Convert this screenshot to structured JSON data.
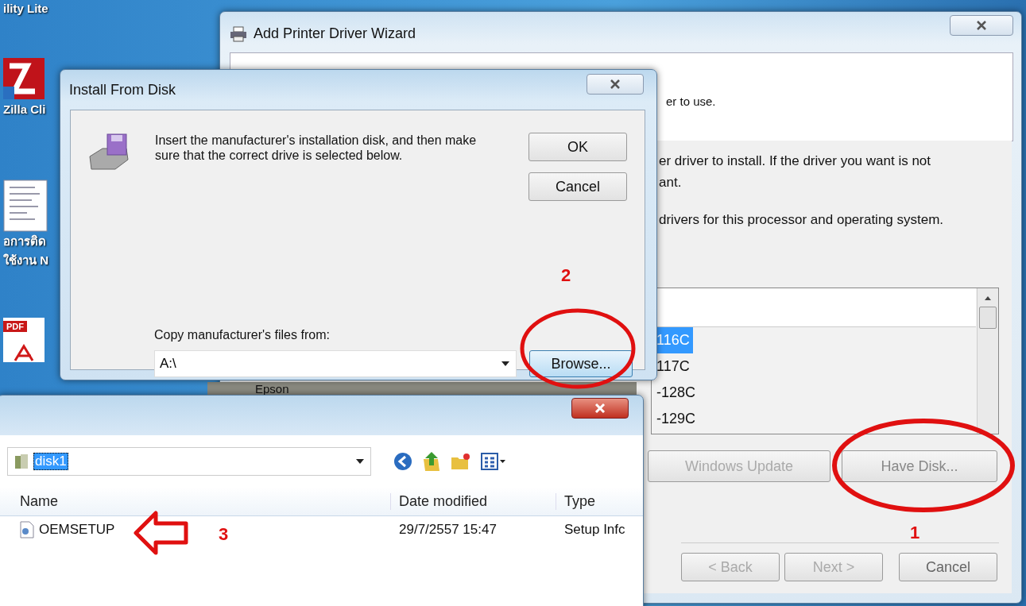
{
  "desktop": {
    "icons": [
      {
        "kind": "none",
        "lines": [
          "ility Lite"
        ]
      },
      {
        "kind": "filezilla",
        "lines": [
          "Zilla Cli"
        ]
      },
      {
        "kind": "document",
        "lines": [
          "อการติด",
          "ใช้งาน N"
        ]
      },
      {
        "kind": "pdf",
        "badge": "PDF"
      }
    ]
  },
  "wizard": {
    "title": "Add Printer Driver Wizard",
    "header_text": "er to use.",
    "body_lines": [
      "er driver to install. If the driver you want is not",
      "ant."
    ],
    "filter_text": "drivers for this processor and operating system.",
    "manufacturer_item": "Epson",
    "printer_items": [
      {
        "label": "116C",
        "selected": true
      },
      {
        "label": "117C",
        "selected": false
      },
      {
        "label": "-128C",
        "selected": false
      },
      {
        "label": "-129C",
        "selected": false
      }
    ],
    "buttons": [
      {
        "label": "Windows Update",
        "disabled": true
      },
      {
        "label": "Have Disk...",
        "disabled": false
      }
    ],
    "nav_buttons": [
      {
        "label": "< Back",
        "disabled": true
      },
      {
        "label": "Next >",
        "disabled": true
      },
      {
        "label": "Cancel",
        "disabled": false
      }
    ]
  },
  "install_dialog": {
    "title": "Install From Disk",
    "message": "Insert the manufacturer's installation disk, and then make sure that the correct drive is selected below.",
    "buttons": [
      "OK",
      "Cancel"
    ],
    "copy_label": "Copy manufacturer's files from:",
    "source_value": "A:\\",
    "browse_button": "Browse..."
  },
  "file_dialog": {
    "address": "disk1",
    "columns": [
      "Name",
      "Date modified",
      "Type"
    ],
    "rows": [
      {
        "name": "OEMSETUP",
        "date": "29/7/2557 15:47",
        "type": "Setup Infc"
      }
    ]
  },
  "annotations": {
    "step_numbers": [
      "1",
      "2",
      "3"
    ]
  }
}
